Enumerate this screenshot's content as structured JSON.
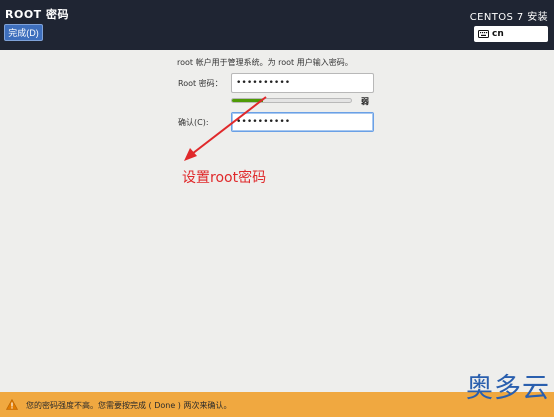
{
  "header": {
    "page_title": "ROOT 密码",
    "done_label": "完成(D)",
    "product_title": "CENTOS 7 安装",
    "keyboard_layout": "cn"
  },
  "form": {
    "description": "root 帐户用于管理系统。为 root 用户输入密码。",
    "password_label": "Root 密码：",
    "password_value": "••••••••••",
    "strength_label": "弱",
    "strength_level": 0.26,
    "confirm_label": "确认(C):",
    "confirm_value": "••••••••••"
  },
  "annotation": {
    "text": "设置root密码",
    "color": "#e0292b"
  },
  "footer": {
    "warning_text": "您的密码强度不高。您需要按完成 ( Done ) 两次来确认。",
    "warning_icon": "warning-triangle-icon"
  },
  "watermark": {
    "text": "奥多云"
  },
  "colors": {
    "header_bg": "#1f2533",
    "accent": "#3e6fbd",
    "warning_bg": "#f0a840",
    "strength_fill": "#4e9a06"
  }
}
